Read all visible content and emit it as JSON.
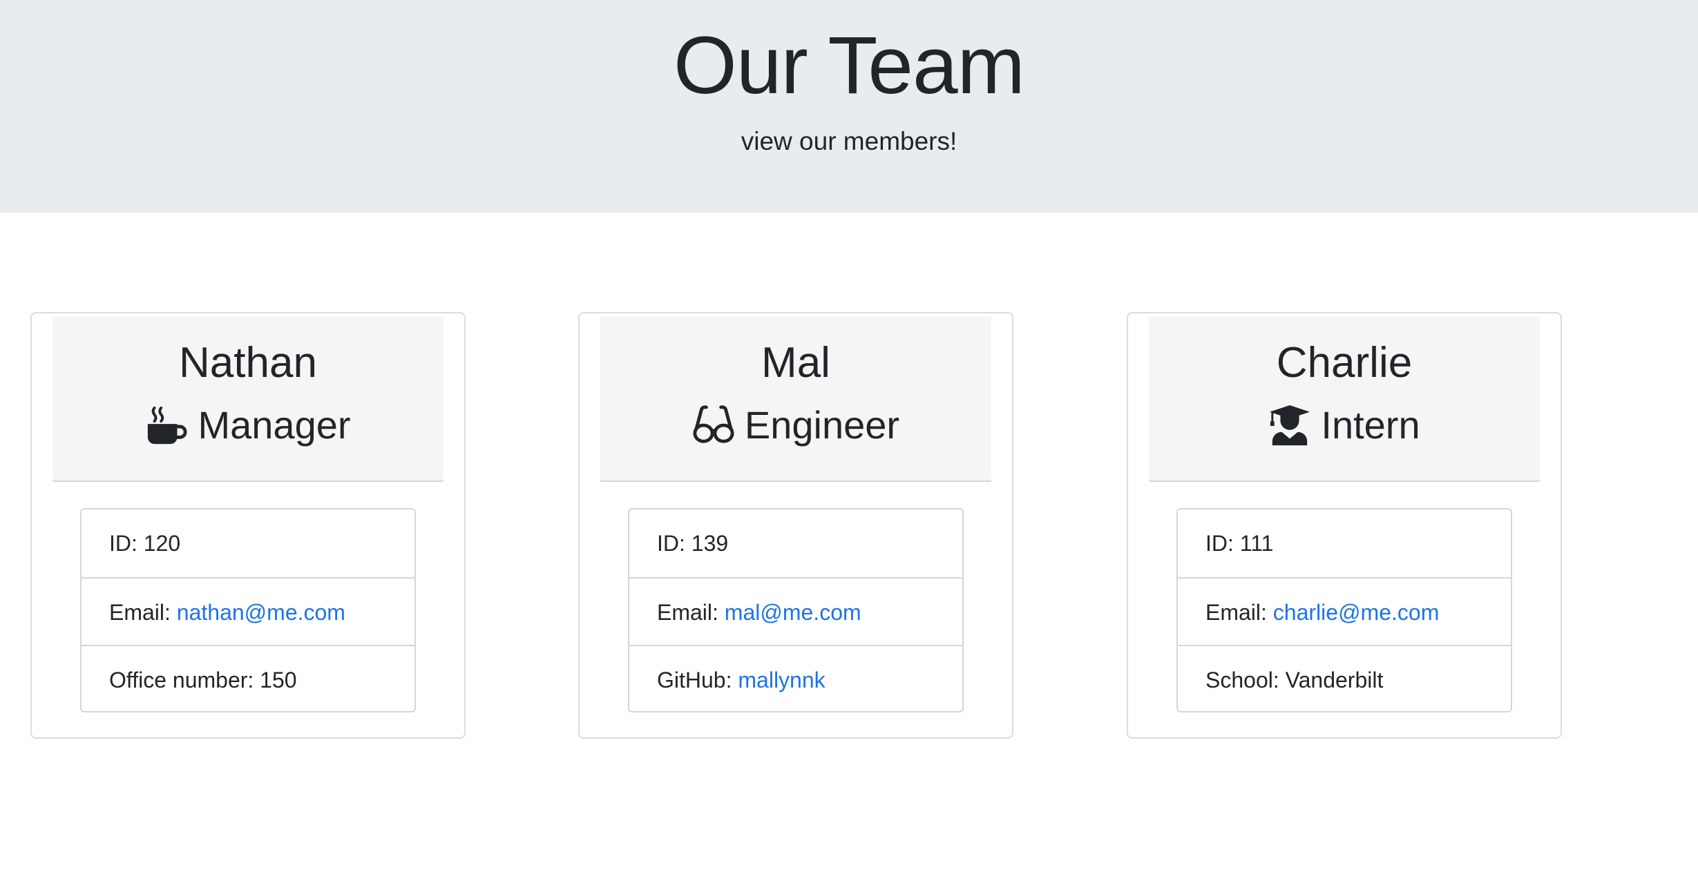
{
  "header": {
    "title": "Our Team",
    "subtitle": "view our members!"
  },
  "colors": {
    "jumbotron_bg": "#e9ecef",
    "card_header_bg": "#f5f5f5",
    "link": "#1e73e8",
    "text": "#212529"
  },
  "members": [
    {
      "name": "Nathan",
      "role": "Manager",
      "role_icon": "coffee-mug-icon",
      "id_label": "ID: 120",
      "email_label": "Email: ",
      "email": "nathan@me.com",
      "extra_label": "Office number: 150",
      "extra_link": ""
    },
    {
      "name": "Mal",
      "role": "Engineer",
      "role_icon": "glasses-icon",
      "id_label": "ID: 139",
      "email_label": "Email: ",
      "email": "mal@me.com",
      "extra_label": "GitHub: ",
      "extra_link": "mallynnk"
    },
    {
      "name": "Charlie",
      "role": "Intern",
      "role_icon": "graduate-icon",
      "id_label": "ID: 111",
      "email_label": "Email: ",
      "email": "charlie@me.com",
      "extra_label": "School: Vanderbilt",
      "extra_link": ""
    }
  ]
}
